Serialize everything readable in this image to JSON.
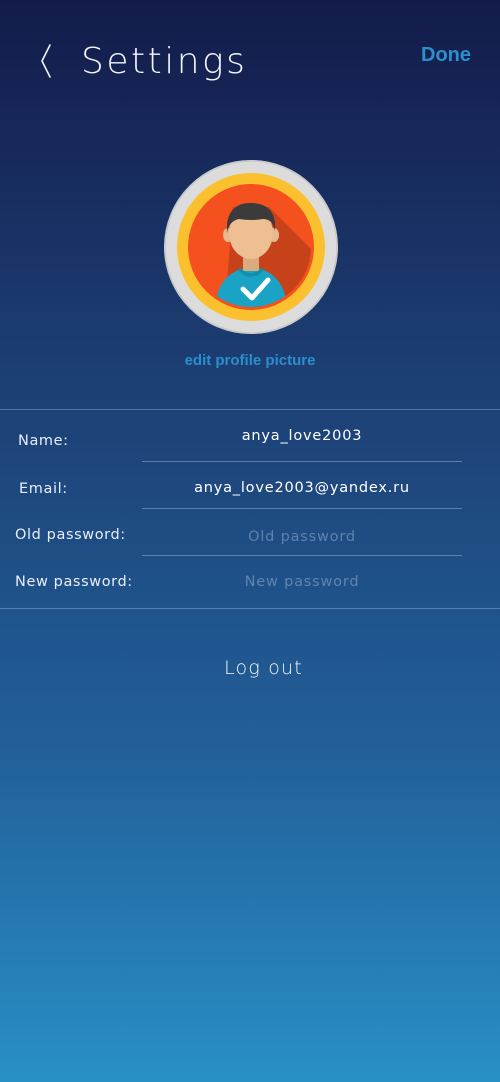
{
  "header": {
    "back_icon": "chevron-left-icon",
    "title": "Settings",
    "done_label": "Done"
  },
  "profile": {
    "avatar_icon": "user-avatar-checkmark-icon",
    "edit_label": "edit profile picture"
  },
  "form": {
    "name": {
      "label": "Name:",
      "value": "anya_love2003",
      "placeholder": ""
    },
    "email": {
      "label": "Email:",
      "value": "anya_love2003@yandex.ru",
      "placeholder": ""
    },
    "old_password": {
      "label": "Old password:",
      "value": "",
      "placeholder": "Old password"
    },
    "new_password": {
      "label": "New password:",
      "value": "",
      "placeholder": "New password"
    }
  },
  "logout_label": "Log out",
  "colors": {
    "accent": "#2b8fcc",
    "background_top": "#131b4a",
    "background_bottom": "#2990c6",
    "avatar_ring": "#dcdcdc",
    "avatar_gold": "#fbc02d",
    "avatar_red": "#f4511e"
  }
}
